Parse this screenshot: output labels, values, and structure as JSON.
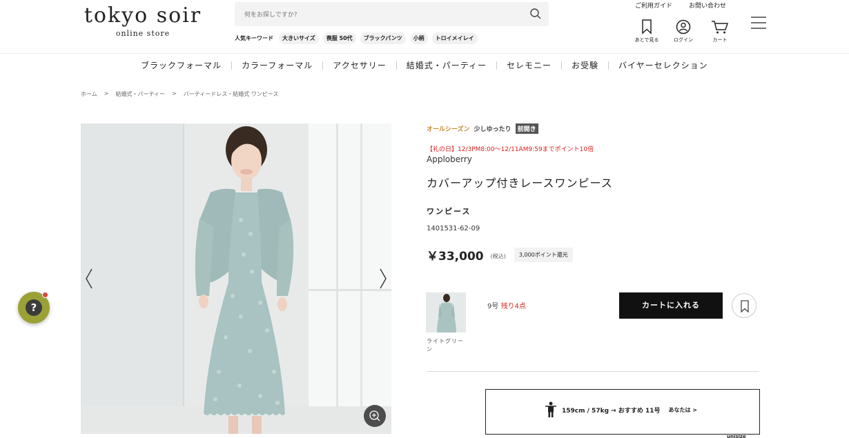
{
  "header": {
    "logo_main": "tokyo soir",
    "logo_sub": "online store",
    "search_placeholder": "何をお探しですか?",
    "keywords_title": "人気キーワード",
    "keywords": [
      "大きいサイズ",
      "喪服 50代",
      "ブラックパンツ",
      "小柄",
      "トロイメイレイ"
    ],
    "links": [
      "ご利用ガイド",
      "お問い合わせ"
    ],
    "icons": [
      {
        "label": "あとで見る",
        "icon": "bookmark-icon"
      },
      {
        "label": "ログイン",
        "icon": "user-icon"
      },
      {
        "label": "カート",
        "icon": "cart-icon"
      }
    ]
  },
  "nav": {
    "categories": [
      "ブラックフォーマル",
      "カラーフォーマル",
      "アクセサリー",
      "結婚式・パーティー",
      "セレモニー",
      "お受験",
      "バイヤーセレクション"
    ]
  },
  "breadcrumb": [
    "ホーム",
    ">",
    "結婚式・パーティー",
    ">",
    "パーティードレス・結婚式 ワンピース"
  ],
  "product": {
    "tag_season": "オールシーズン",
    "tag_fit": "少しゆったり",
    "tag_front": "前開き",
    "promo": "【礼の日】12/3PM8:00〜12/11AM9:59までポイント10倍",
    "brand": "Apploberry",
    "name": "カバーアップ付きレースワンピース",
    "type": "ワンピース",
    "code": "1401531-62-09",
    "price": "￥33,000",
    "tax_label": "(税込)",
    "points": "3,000ポイント還元",
    "color_label": "ライトグリーン",
    "size": "9号",
    "stock": "残り4点",
    "cart_label": "カートに入れる",
    "fit": "159cm / 57kg → おすすめ 11号",
    "fit_you": "あなたは >",
    "fit_brand": "unisize"
  },
  "colors": {
    "accent_season": "#c4882f",
    "promo_red": "#d9201b",
    "help_bubble": "#9aa237",
    "dress": "#a8c3c1"
  }
}
